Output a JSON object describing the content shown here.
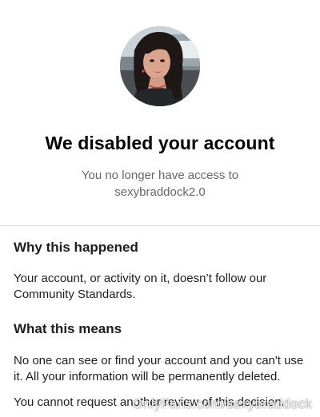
{
  "header": {
    "avatar_alt": "profile photo",
    "title": "We disabled your account",
    "subtitle_line1": "You no longer have access to",
    "subtitle_line2": "sexybraddock2.0"
  },
  "sections": [
    {
      "heading": "Why this happened",
      "paragraphs": [
        "Your account, or activity on it, doesn’t follow our Community Standards."
      ]
    },
    {
      "heading": "What this means",
      "paragraphs": [
        "No one can see or find your account and you can't use it. All your information will be permanently deleted.",
        "You cannot request another review of this decision."
      ]
    }
  ],
  "watermark": "OnlyFans.com/sexybraddock",
  "colors": {
    "divider": "#dadde1",
    "subtitle": "#65676b",
    "text": "#1c1e21"
  }
}
